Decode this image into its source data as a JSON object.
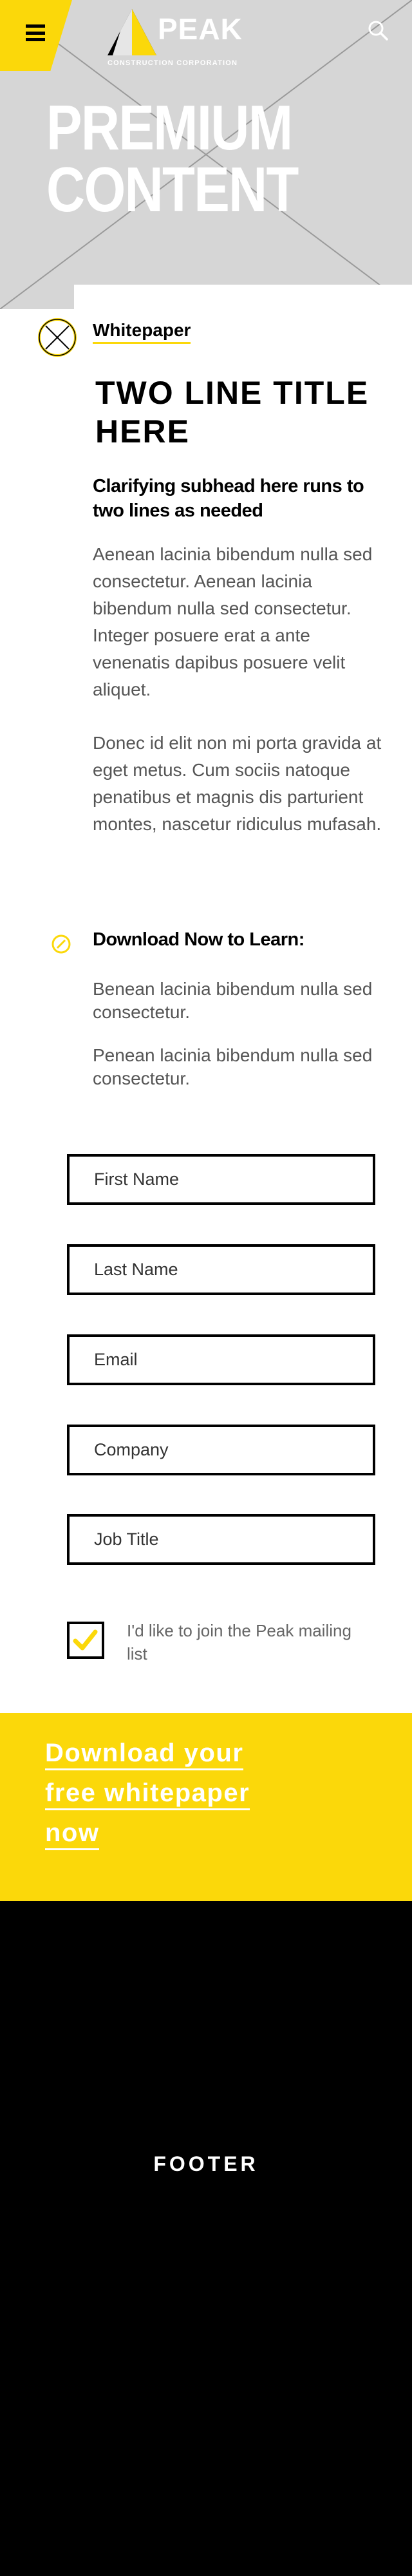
{
  "brand": {
    "name": "PEAK",
    "tagline": "CONSTRUCTION CORPORATION"
  },
  "hero": {
    "title_line1": "PREMIUM",
    "title_line2": "CONTENT"
  },
  "document": {
    "type": "Whitepaper",
    "title": "TWO LINE TITLE HERE",
    "subhead": "Clarifying subhead here runs to two lines as needed",
    "paragraphs": [
      "Aenean lacinia bibendum nulla sed consectetur. Aenean lacinia bibendum nulla sed consectetur. Integer posuere erat a ante venenatis dapibus posuere velit aliquet.",
      "Donec id elit non mi porta gravida at eget metus. Cum sociis natoque penatibus et magnis dis parturient montes, nascetur ridiculus mufasah."
    ]
  },
  "learn": {
    "heading": "Download Now to Learn:",
    "items": [
      "Benean lacinia bibendum nulla sed consectetur.",
      "Penean lacinia bibendum nulla sed consectetur."
    ]
  },
  "form": {
    "first_name": "First Name",
    "last_name": "Last Name",
    "email": "Email",
    "company": "Company",
    "job_title": "Job Title",
    "mailing_list_label": "I'd like to join the Peak mailing list",
    "mailing_list_checked": true
  },
  "cta": {
    "line1": "Download your",
    "line2": "free whitepaper",
    "line3": "now"
  },
  "footer": {
    "label": "FOOTER"
  },
  "colors": {
    "accent": "#fbd80a",
    "hero_bg": "#d6d6d6",
    "footer_bg": "#000000",
    "text": "#000000",
    "body_text": "#555555"
  },
  "icons": {
    "menu": "hamburger-icon",
    "search": "search-icon",
    "badge": "x-circle-icon",
    "learn": "slash-circle-icon",
    "check": "checkmark-icon"
  }
}
